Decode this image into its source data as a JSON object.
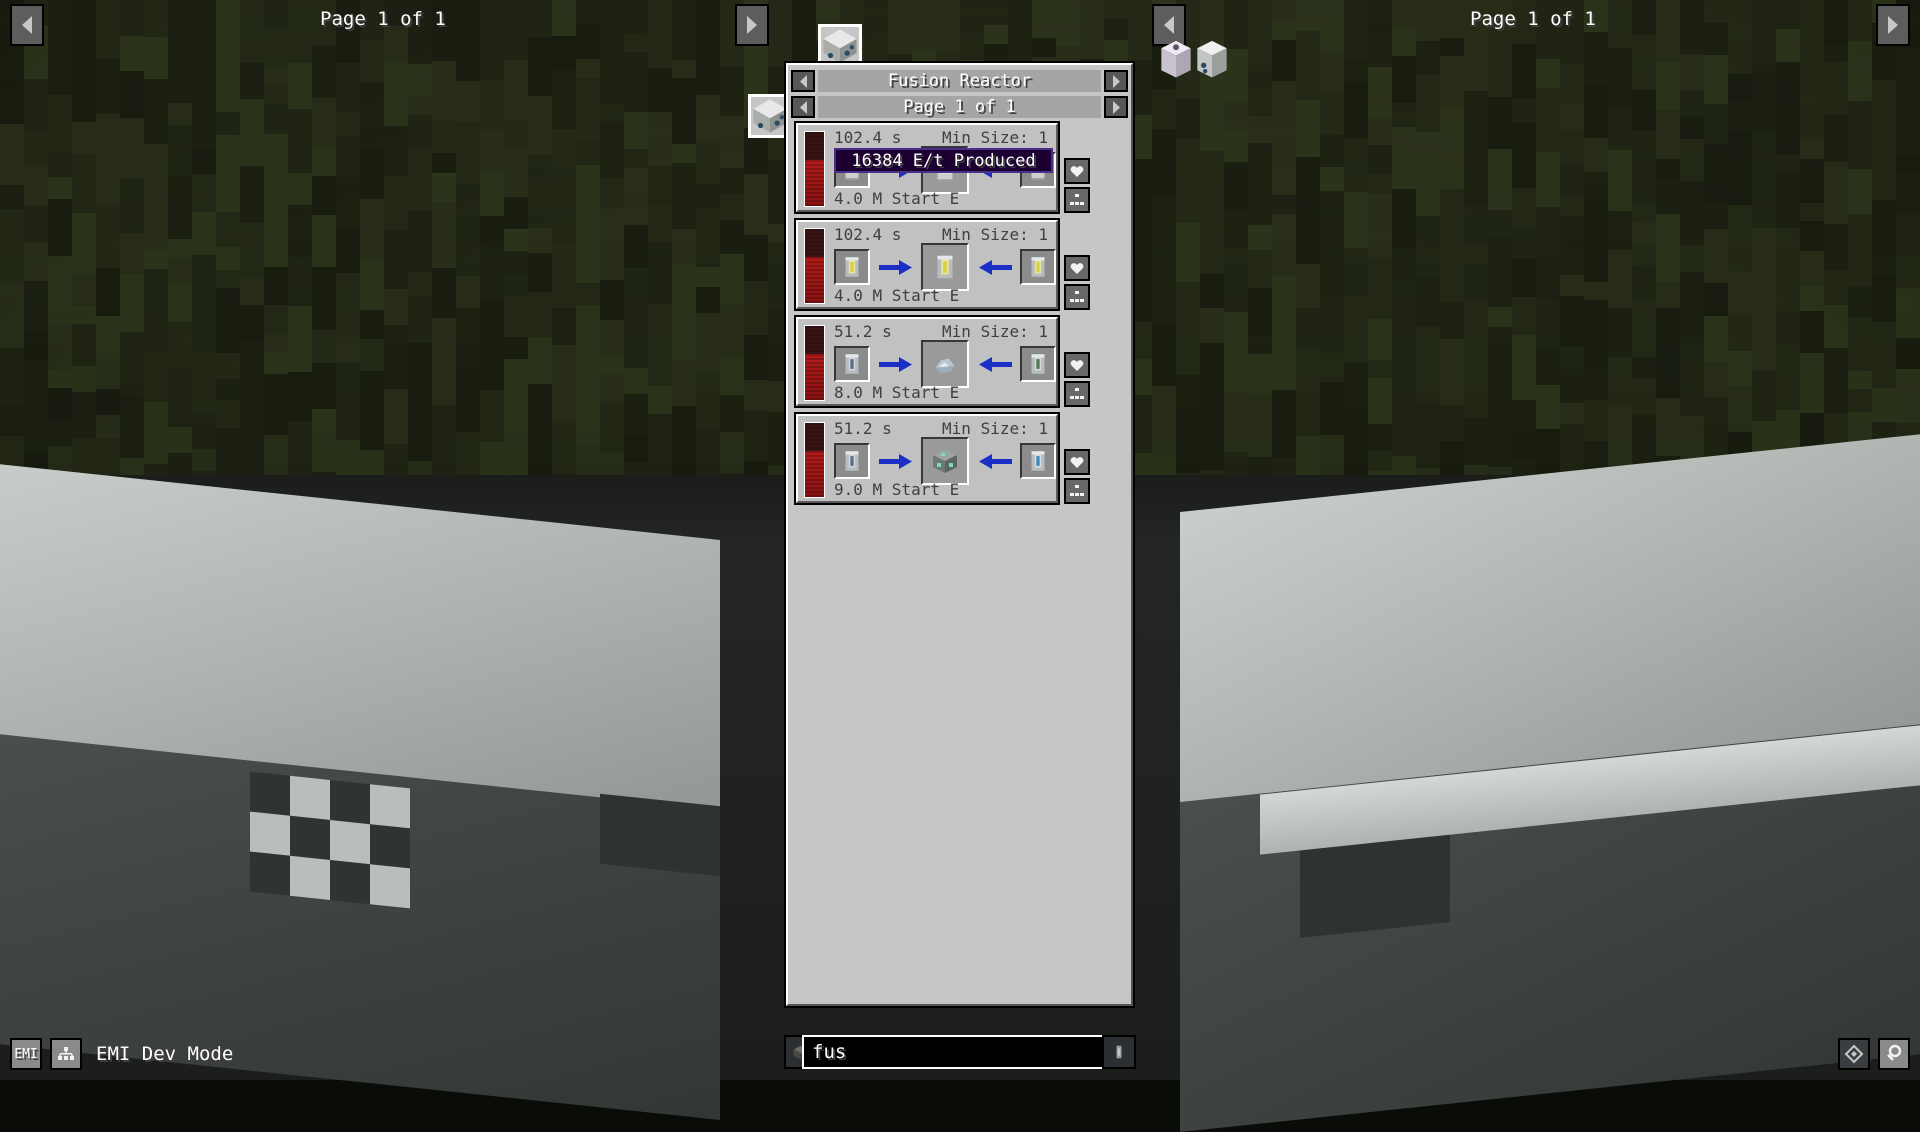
{
  "window": {
    "title": "Minecraft EMI Recipe Viewer"
  },
  "world_nav": {
    "left": {
      "page_label": "Page 1 of 1",
      "prev_icon": "chevron-left-icon",
      "next_icon": "chevron-right-icon"
    },
    "right": {
      "page_label": "Page 1 of 1",
      "prev_icon": "chevron-left-icon",
      "next_icon": "chevron-right-icon"
    }
  },
  "floating_items": [
    {
      "name": "fusion-reactor-top",
      "icon": "fusion-reactor-block"
    },
    {
      "name": "fusion-reactor-left",
      "icon": "fusion-reactor-block"
    },
    {
      "name": "right-item-1",
      "icon": "white-pillar-block"
    },
    {
      "name": "right-item-2",
      "icon": "fusion-reactor-block"
    }
  ],
  "panel": {
    "category_nav": {
      "title": "Fusion Reactor",
      "prev_icon": "chevron-left-icon",
      "next_icon": "chevron-right-icon"
    },
    "page_nav": {
      "title": "Page 1 of 1",
      "prev_icon": "chevron-left-icon",
      "next_icon": "chevron-right-icon"
    },
    "recipes": [
      {
        "id": "recipe-1",
        "time": "102.4 s",
        "min_size": "Min Size: 1",
        "start_energy": "4.0 M Start E",
        "energy_produced": "16384 E/t Produced",
        "has_energy_badge": true,
        "input_left": "red-cell-item",
        "input_right": "yellow-cell-item",
        "output": "yellow-cell-item",
        "favorite_icon": "heart-icon",
        "tree_icon": "recipe-tree-icon"
      },
      {
        "id": "recipe-2",
        "time": "102.4 s",
        "min_size": "Min Size: 1",
        "start_energy": "4.0 M Start E",
        "energy_produced": "",
        "has_energy_badge": false,
        "input_left": "yellow-cell-item",
        "input_right": "yellow-cell-item",
        "output": "yellow-cell-item",
        "favorite_icon": "heart-icon",
        "tree_icon": "recipe-tree-icon"
      },
      {
        "id": "recipe-3",
        "time": "51.2 s",
        "min_size": "Min Size: 1",
        "start_energy": "8.0 M Start E",
        "energy_produced": "",
        "has_energy_badge": false,
        "input_left": "blue-cell-item",
        "input_right": "green-cell-item",
        "output": "silver-dust-item",
        "favorite_icon": "heart-icon",
        "tree_icon": "recipe-tree-icon"
      },
      {
        "id": "recipe-4",
        "time": "51.2 s",
        "min_size": "Min Size: 1",
        "start_energy": "9.0 M Start E",
        "energy_produced": "",
        "has_energy_badge": false,
        "input_left": "blue-cell-item",
        "input_right": "cyan-cell-item",
        "output": "diamond-ore-block",
        "favorite_icon": "heart-icon",
        "tree_icon": "recipe-tree-icon"
      }
    ]
  },
  "bottom_bar": {
    "emi_button_label": "EMI",
    "tree_button_icon": "hierarchy-icon",
    "dev_mode_label": "EMI Dev Mode",
    "search": {
      "value": "fus",
      "placeholder": ""
    },
    "right_buttons": [
      {
        "name": "diamond-filter-button",
        "icon": "diamond-icon"
      },
      {
        "name": "search-toggle-button",
        "icon": "magnifier-icon"
      }
    ]
  },
  "colors": {
    "panel_bg": "#c6c6c6",
    "card_bg": "#c1c1c1",
    "nav_title_bg": "#a5a5a5",
    "energy_bar_red": "#b51b1b",
    "badge_purple_border": "#4b2d8a",
    "badge_purple_bg": "#1b0031",
    "arrow_blue": "#1a2fc4"
  }
}
